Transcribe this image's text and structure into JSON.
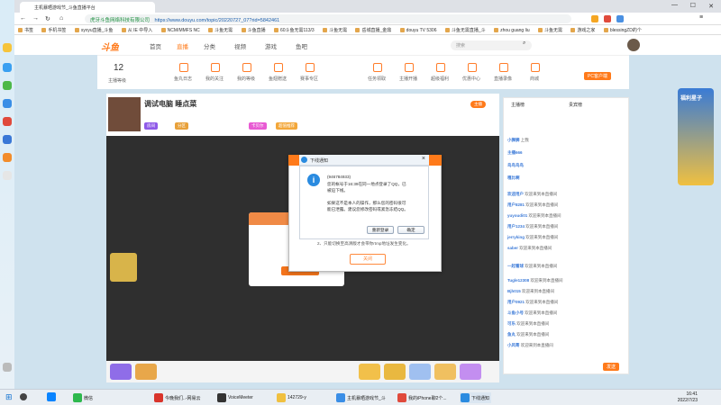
{
  "browser": {
    "tabs": [
      {
        "label": "主机暴晒游戏节_斗鱼直播平台"
      }
    ],
    "url_secure_label": "虎牙斗鱼网络科技有限公司",
    "url": "https://www.douyu.com/topic/20220727_07?rid=5842461",
    "bookmarks": [
      "书签",
      "手机书签",
      "syxyu直播_斗鱼",
      "从 IE 中导入",
      "NCM/MMFS NC",
      "斗鱼无需",
      "斗鱼直播",
      "60斗鱼无需113/3",
      "斗鱼无需",
      "岳城直播_金鼎",
      "douyu TV 5306",
      "斗鱼无需直播_斗",
      "zhou guang liu",
      "斗鱼无需",
      "游戏之家",
      "blessingZD的个"
    ]
  },
  "site": {
    "logo": "斗鱼",
    "nav": [
      "首页",
      "直播",
      "分类",
      "视频",
      "游戏",
      "鱼吧"
    ],
    "search_placeholder": "搜索",
    "subnav": {
      "level": "12",
      "level_label": "主播等级",
      "items": [
        "鱼翅充值",
        "鱼丸日志",
        "我的关注",
        "我的等级",
        "鱼翅赠送",
        "赛事专区",
        "消息中心",
        "天天抽奖",
        "任务领取",
        "主播开播",
        "超级福利",
        "优惠中心",
        "直播录像",
        "直播回看",
        "商城",
        "分享"
      ],
      "pc_label": "PC客户端"
    },
    "room": {
      "title": "调试电脑 睡点菜",
      "tags": [
        "房间",
        "分区",
        "卡贝尔",
        "超值推荐"
      ],
      "badge": "主播"
    },
    "chat": {
      "tabs": [
        "主播榜",
        "贵宾榜"
      ],
      "lines": [
        {
          "user": "小狮狮",
          "text": "上我"
        },
        {
          "user": "主播666",
          "text": ""
        },
        {
          "user": "鸟鸟鸟鸟",
          "text": ""
        },
        {
          "user": "嘎比啊",
          "text": ""
        },
        {
          "user": "欢迎用户",
          "text": "欢迎来到本直播间"
        },
        {
          "user": "用户8281",
          "text": "欢迎来到本直播间"
        },
        {
          "user": "yuyoudi01",
          "text": "欢迎来到本直播间"
        },
        {
          "user": "用户1234",
          "text": "欢迎来到本直播间"
        },
        {
          "user": "jerryking",
          "text": "欢迎来到本直播间"
        },
        {
          "user": "saber",
          "text": "欢迎来到本直播间"
        },
        {
          "user": "一起看球",
          "text": "欢迎来到本直播间"
        },
        {
          "user": "Tugle12308",
          "text": "欢迎来到本直播间"
        },
        {
          "user": "Bjh015",
          "text": "欢迎来到本直播间"
        },
        {
          "user": "用户0921",
          "text": "欢迎来到本直播间"
        },
        {
          "user": "斗鱼小号",
          "text": "欢迎来到本直播间"
        },
        {
          "user": "可乐",
          "text": "欢迎来到本直播间"
        },
        {
          "user": "鱼丸",
          "text": "欢迎来到本直播间"
        },
        {
          "user": "小风哥",
          "text": "欢迎来到本直播间"
        }
      ],
      "send_label": "发送"
    },
    "promo_label": "福利星子"
  },
  "dialog": {
    "title": "下线通知",
    "account": "(946784933)",
    "message_line1": "您的帐号于16:39在同一地点登录了QQ，已",
    "message_line2": "被迫下线。",
    "warn_line1": "如果这不是本人的操作，那么您的密码很可",
    "warn_line2": "能已泄露。建议您修改密码或紧急冻结QQ。",
    "relogin_label": "重新登录",
    "ok_label": "确定"
  },
  "background_dialog": {
    "tip": "2、只能切换至高清版才会带你rtmp地址发生变化。",
    "confirm_label": "关闭"
  },
  "taskbar": {
    "items": [
      "微信",
      "今晚我们..-网易云",
      "VoiceMeeter",
      "142729-y",
      "主机暴晒游戏节_斗",
      "我的iPhone聊2个...",
      "下线通知"
    ],
    "time": "16:41",
    "date": "2022/7/23"
  },
  "colors": {
    "accent": "#ff7a1a",
    "qq_blue": "#2a8be0"
  }
}
